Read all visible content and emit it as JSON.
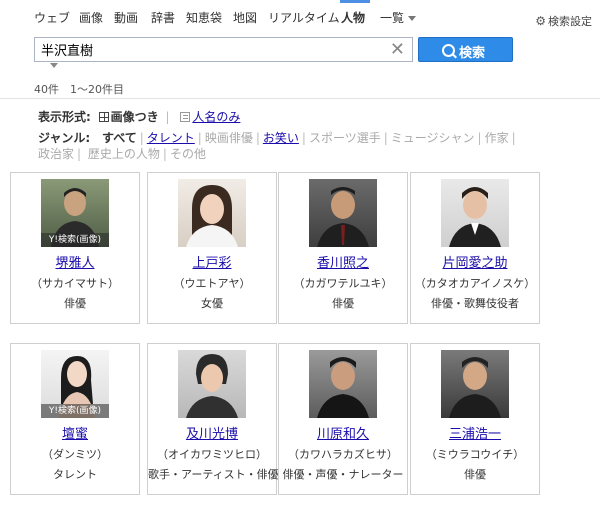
{
  "nav": {
    "tabs": [
      "ウェブ",
      "画像",
      "動画",
      "辞書",
      "知恵袋",
      "地図",
      "リアルタイム",
      "人物",
      "一覧"
    ],
    "settings": "検索設定"
  },
  "search": {
    "query": "半沢直樹",
    "button": "検索"
  },
  "result_count": "40件　1〜20件目",
  "display": {
    "label": "表示形式:",
    "with_images": "画像つき",
    "names_only": "人名のみ"
  },
  "genre": {
    "label": "ジャンル:",
    "items": [
      "すべて",
      "タレント",
      "映画俳優",
      "お笑い",
      "スポーツ選手",
      "ミュージシャン",
      "作家",
      "政治家",
      "歴史上の人物",
      "その他"
    ]
  },
  "people": [
    {
      "name": "堺雅人",
      "kana": "（サカイマサト）",
      "job": "俳優",
      "watermark": "Y!検索(画像)"
    },
    {
      "name": "上戸彩",
      "kana": "（ウエトアヤ）",
      "job": "女優",
      "watermark": ""
    },
    {
      "name": "香川照之",
      "kana": "（カガワテルユキ）",
      "job": "俳優",
      "watermark": ""
    },
    {
      "name": "片岡愛之助",
      "kana": "（カタオカアイノスケ）",
      "job": "俳優・歌舞伎役者",
      "watermark": ""
    },
    {
      "name": "壇蜜",
      "kana": "（ダンミツ）",
      "job": "タレント",
      "watermark": "Y!検索(画像)"
    },
    {
      "name": "及川光博",
      "kana": "（オイカワミツヒロ）",
      "job": "歌手・アーティスト・俳優",
      "watermark": ""
    },
    {
      "name": "川原和久",
      "kana": "（カワハラカズヒサ）",
      "job": "俳優・声優・ナレーター",
      "watermark": ""
    },
    {
      "name": "三浦浩一",
      "kana": "（ミウラコウイチ）",
      "job": "俳優",
      "watermark": ""
    }
  ]
}
